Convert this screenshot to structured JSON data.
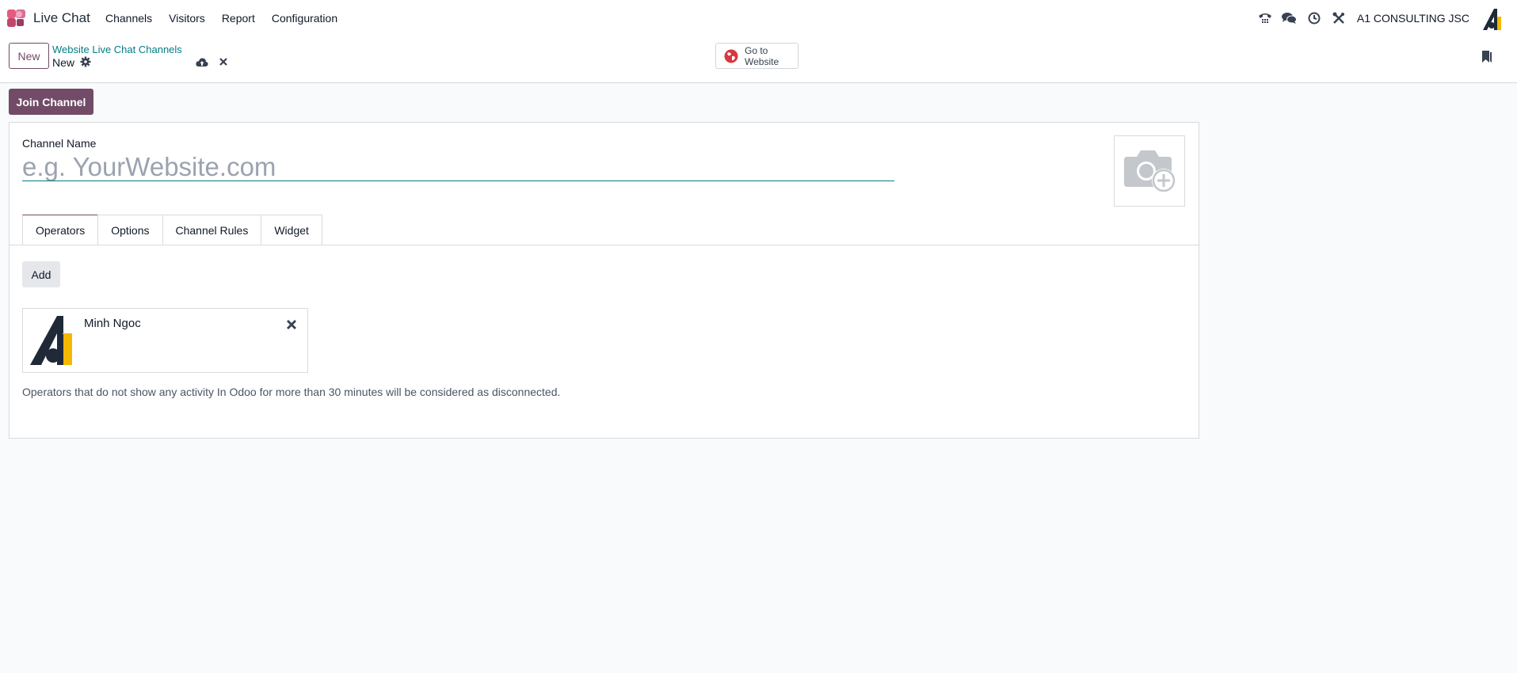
{
  "navbar": {
    "app_name": "Live Chat",
    "menu": [
      "Channels",
      "Visitors",
      "Report",
      "Configuration"
    ],
    "company": "A1 CONSULTING JSC",
    "icons": [
      "phone-icon",
      "chat-icon",
      "clock-icon",
      "tools-icon"
    ]
  },
  "control_panel": {
    "new_label": "New",
    "breadcrumb_parent": "Website Live Chat Channels",
    "breadcrumb_current": "New",
    "go_to_website_line1": "Go to",
    "go_to_website_line2": "Website"
  },
  "actions": {
    "join_label": "Join Channel"
  },
  "form": {
    "channel_name_label": "Channel Name",
    "channel_name_placeholder": "e.g. YourWebsite.com",
    "channel_name_value": "",
    "tabs": [
      "Operators",
      "Options",
      "Channel Rules",
      "Widget"
    ],
    "active_tab": "Operators",
    "add_label": "Add",
    "operators": [
      {
        "name": "Minh Ngoc"
      }
    ],
    "help_text": "Operators that do not show any activity In Odoo for more than 30 minutes will be considered as disconnected."
  },
  "colors": {
    "brand": "#714b67",
    "link": "#017e84",
    "background": "#f9fafb"
  }
}
